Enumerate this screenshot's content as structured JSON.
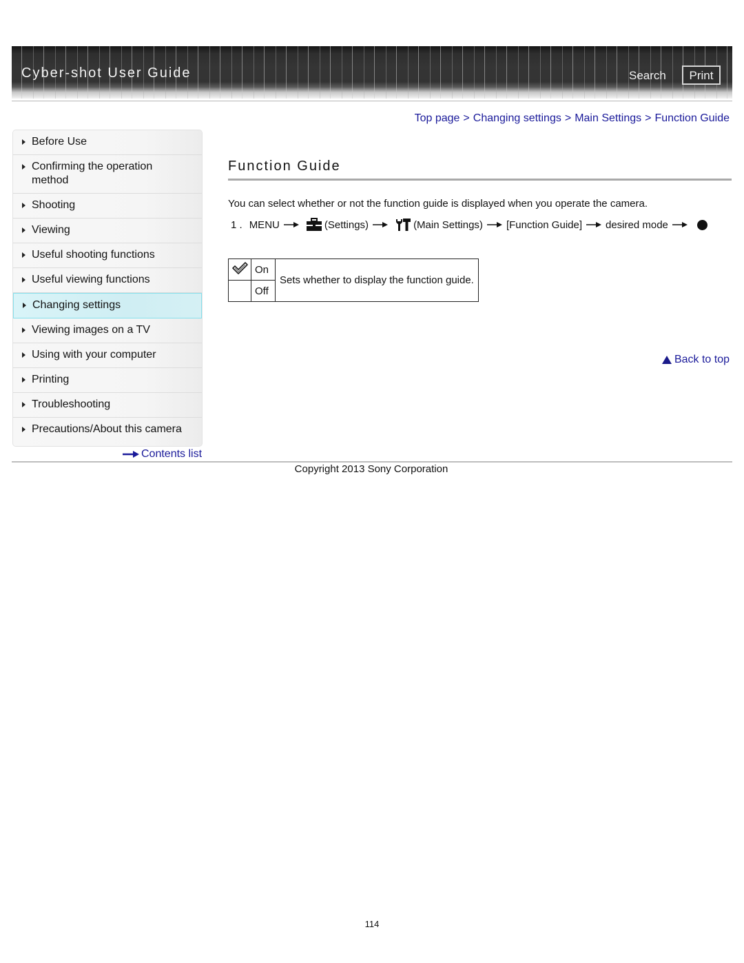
{
  "header": {
    "title": "Cyber-shot User Guide",
    "search_label": "Search",
    "print_label": "Print"
  },
  "breadcrumb": [
    {
      "label": "Top page"
    },
    {
      "label": "Changing settings"
    },
    {
      "label": "Main Settings"
    },
    {
      "label": "Function Guide"
    }
  ],
  "breadcrumb_separator": ">",
  "sidebar": {
    "items": [
      {
        "label": "Before Use",
        "active": false
      },
      {
        "label": "Confirming the operation method",
        "active": false
      },
      {
        "label": "Shooting",
        "active": false
      },
      {
        "label": "Viewing",
        "active": false
      },
      {
        "label": "Useful shooting functions",
        "active": false
      },
      {
        "label": "Useful viewing functions",
        "active": false
      },
      {
        "label": "Changing settings",
        "active": true
      },
      {
        "label": "Viewing images on a TV",
        "active": false
      },
      {
        "label": "Using with your computer",
        "active": false
      },
      {
        "label": "Printing",
        "active": false
      },
      {
        "label": "Troubleshooting",
        "active": false
      },
      {
        "label": "Precautions/About this camera",
        "active": false
      }
    ],
    "contents_link": "Contents list"
  },
  "main": {
    "title": "Function Guide",
    "intro": "You can select whether or not the function guide is displayed when you operate the camera.",
    "step": {
      "number": "1 .",
      "menu": "MENU",
      "settings_icon": "toolbox-icon",
      "settings_label": "(Settings)",
      "main_settings_icon": "wrench-hammer-icon",
      "main_settings_label": "(Main Settings)",
      "function_guide_label": "[Function Guide]",
      "desired_mode_label": "desired mode",
      "confirm_icon": "center-button-dot-icon"
    },
    "options_table": {
      "rows": [
        {
          "default_icon": "checkmark-icon",
          "is_default": true,
          "label": "On"
        },
        {
          "default_icon": "",
          "is_default": false,
          "label": "Off"
        }
      ],
      "description": "Sets whether to display the function guide."
    },
    "back_to_top": "Back to top"
  },
  "footer": {
    "copyright": "Copyright 2013 Sony Corporation",
    "page_number": "114"
  },
  "colors": {
    "link": "#1a1a9a",
    "active_nav_bg": "#d9f4f8",
    "active_nav_border": "#86e0ec",
    "header_bg": "#333333"
  }
}
